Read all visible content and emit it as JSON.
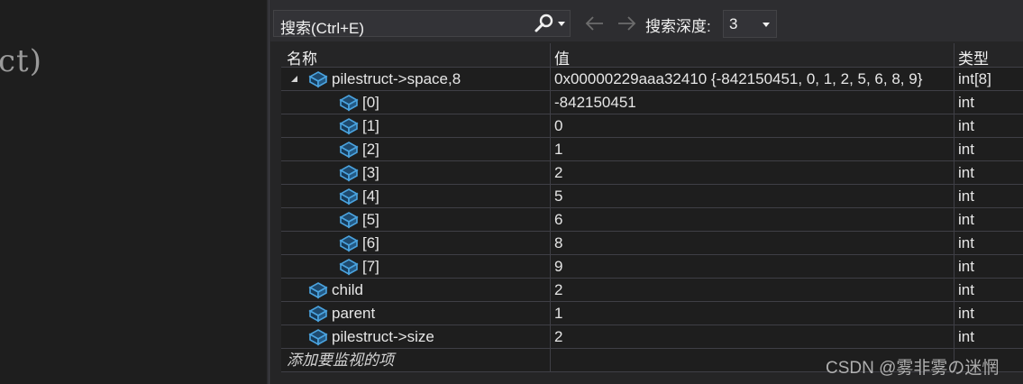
{
  "editor": {
    "code_fragment": "ct)"
  },
  "toolbar": {
    "search_text": "搜索(Ctrl+E)",
    "search_icon": "search-icon",
    "back_icon": "arrow-left-icon",
    "forward_icon": "arrow-right-icon",
    "depth_label": "搜索深度:",
    "depth_value": "3"
  },
  "columns": {
    "name": "名称",
    "value": "值",
    "type": "类型"
  },
  "rows": [
    {
      "name": "pilestruct->space,8",
      "value": "0x00000229aaa32410 {-842150451, 0, 1, 2, 5, 6, 8, 9}",
      "type": "int[8]",
      "expanded": true
    },
    {
      "name": "[0]",
      "value": "-842150451",
      "type": "int"
    },
    {
      "name": "[1]",
      "value": "0",
      "type": "int"
    },
    {
      "name": "[2]",
      "value": "1",
      "type": "int"
    },
    {
      "name": "[3]",
      "value": "2",
      "type": "int"
    },
    {
      "name": "[4]",
      "value": "5",
      "type": "int"
    },
    {
      "name": "[5]",
      "value": "6",
      "type": "int"
    },
    {
      "name": "[6]",
      "value": "8",
      "type": "int"
    },
    {
      "name": "[7]",
      "value": "9",
      "type": "int"
    },
    {
      "name": "child",
      "value": "2",
      "type": "int"
    },
    {
      "name": "parent",
      "value": "1",
      "type": "int"
    },
    {
      "name": "pilestruct->size",
      "value": "2",
      "type": "int"
    }
  ],
  "add_watch_placeholder": "添加要监视的项",
  "watermark": "CSDN @雾非雾の迷惘",
  "colors": {
    "panel_bg": "#252526",
    "row_bg": "#1e1e1e",
    "grid_line": "#3f3f46",
    "icon_blue": "#4aa3df"
  }
}
